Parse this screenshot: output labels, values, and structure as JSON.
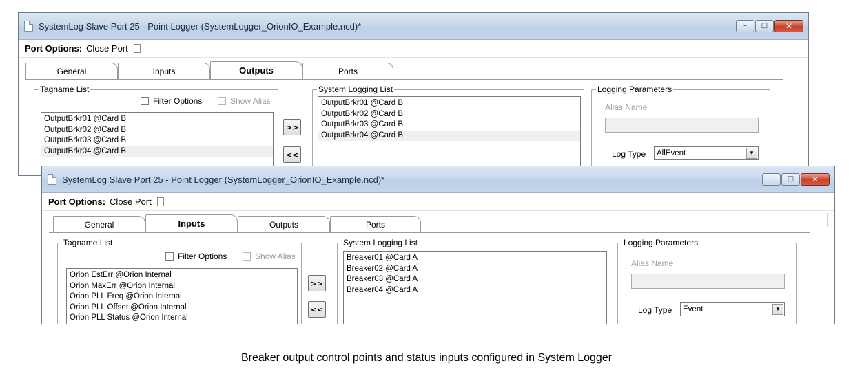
{
  "windows": [
    {
      "title": "SystemLog Slave Port 25 - Point Logger (SystemLogger_OrionIO_Example.ncd)*",
      "port_options_label": "Port Options:",
      "close_port_label": "Close Port",
      "tabs": [
        "General",
        "Inputs",
        "Outputs",
        "Ports"
      ],
      "active_tab": "Outputs",
      "tagname_list": {
        "title": "Tagname List",
        "filter_options_label": "Filter Options",
        "show_alias_label": "Show Alias",
        "items": [
          "OutputBrkr01 @Card B",
          "OutputBrkr02 @Card B",
          "OutputBrkr03 @Card B",
          "OutputBrkr04 @Card B"
        ]
      },
      "add_button_label": ">>",
      "remove_button_label": "<<",
      "system_logging_list": {
        "title": "System Logging List",
        "items": [
          "OutputBrkr01 @Card B",
          "OutputBrkr02 @Card B",
          "OutputBrkr03 @Card B",
          "OutputBrkr04 @Card B"
        ]
      },
      "logging_parameters": {
        "title": "Logging Parameters",
        "alias_name_label": "Alias Name",
        "alias_name_value": "",
        "log_type_label": "Log Type",
        "log_type_value": "AllEvent"
      }
    },
    {
      "title": "SystemLog Slave Port 25 - Point Logger (SystemLogger_OrionIO_Example.ncd)*",
      "port_options_label": "Port Options:",
      "close_port_label": "Close Port",
      "tabs": [
        "General",
        "Inputs",
        "Outputs",
        "Ports"
      ],
      "active_tab": "Inputs",
      "tagname_list": {
        "title": "Tagname List",
        "filter_options_label": "Filter Options",
        "show_alias_label": "Show Alias",
        "items": [
          "Orion EstErr @Orion Internal",
          "Orion MaxErr @Orion Internal",
          "Orion PLL Freq @Orion Internal",
          "Orion PLL Offset @Orion Internal",
          "Orion PLL Status @Orion Internal"
        ]
      },
      "add_button_label": ">>",
      "remove_button_label": "<<",
      "system_logging_list": {
        "title": "System Logging List",
        "items": [
          "Breaker01 @Card A",
          "Breaker02 @Card A",
          "Breaker03 @Card A",
          "Breaker04 @Card A"
        ]
      },
      "logging_parameters": {
        "title": "Logging Parameters",
        "alias_name_label": "Alias Name",
        "alias_name_value": "",
        "log_type_label": "Log Type",
        "log_type_value": "Event"
      }
    }
  ],
  "window_buttons": {
    "minimize": "–",
    "maximize": "□",
    "close": "✕"
  },
  "caption": "Breaker output control points and status inputs configured in System Logger"
}
